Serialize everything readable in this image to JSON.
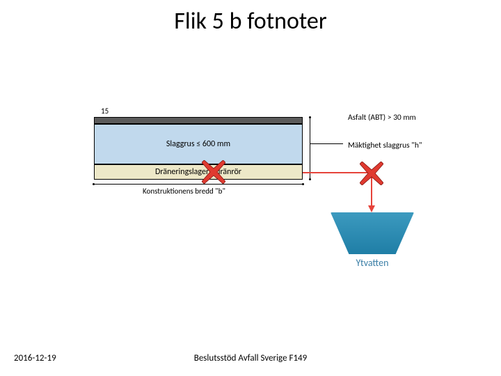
{
  "title": "Flik 5 b fotnoter",
  "date": "2016-12-19",
  "footer": "Beslutsstöd Avfall Sverige F149",
  "diagram": {
    "top_number": "15",
    "asphalt_label": "Asfalt (ABT) > 30 mm",
    "slag_label": "Slaggrus ≤ 600 mm",
    "drain_label": "Dräneringslager / dränrör",
    "width_label": "Konstruktionens bredd \"b\"",
    "thickness_label": "Mäktighet slaggrus \"h\"",
    "water_label": "Ytvatten",
    "cross_marks": [
      {
        "over": "drain-layer"
      },
      {
        "over": "outflow-arrow"
      }
    ]
  }
}
